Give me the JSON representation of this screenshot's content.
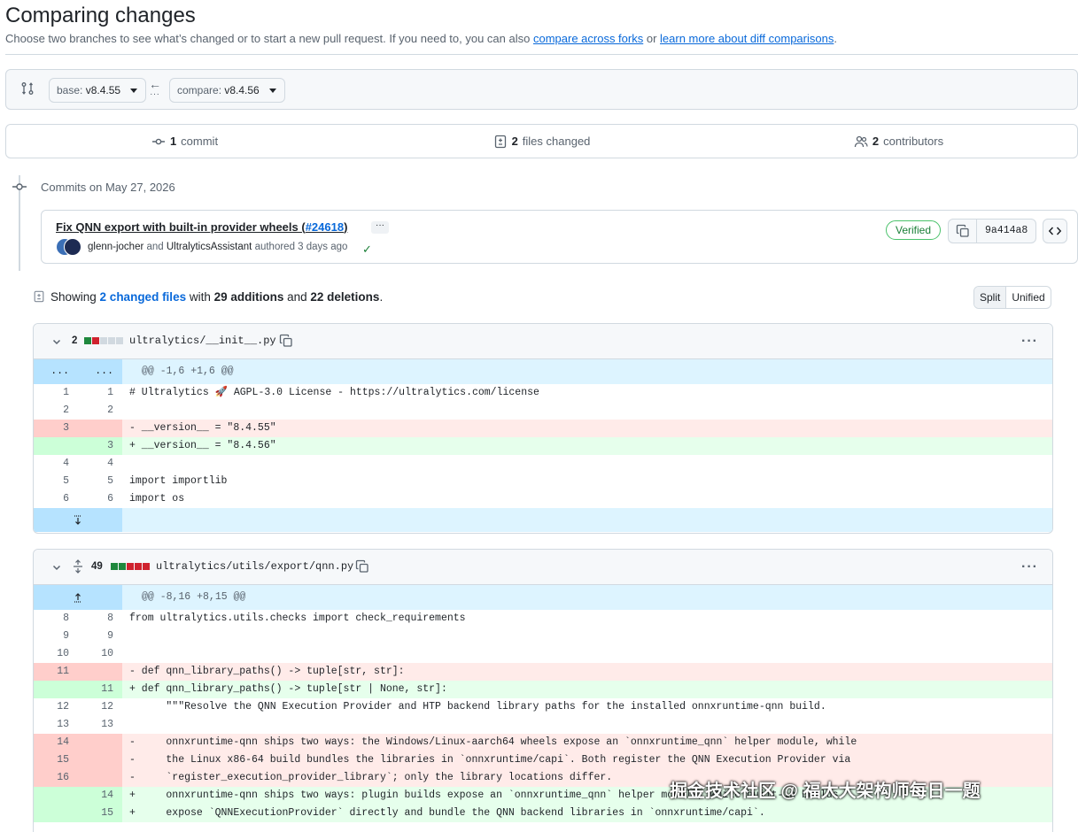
{
  "header": {
    "title": "Comparing changes",
    "subtitle_prefix": "Choose two branches to see what’s changed or to start a new pull request. If you need to, you can also ",
    "link_forks": "compare across forks",
    "subtitle_or": " or ",
    "link_learn": "learn more about diff comparisons",
    "subtitle_end": "."
  },
  "range": {
    "base_label": "base: ",
    "base_value": "v8.4.55",
    "compare_label": "compare: ",
    "compare_value": "v8.4.56",
    "arrow": "←",
    "dots": "..."
  },
  "stats": {
    "commits_count": "1",
    "commits_label": "commit",
    "files_count": "2",
    "files_label": "files changed",
    "contributors_count": "2",
    "contributors_label": "contributors"
  },
  "commits": {
    "date_label": "Commits on May 27, 2026",
    "title": "Fix QNN export with built-in provider wheels (",
    "pr": "#24618",
    "title_end": ")",
    "more": "···",
    "author1": "glenn-jocher",
    "and": " and ",
    "author2": "UltralyticsAssistant",
    "authored": " authored 3 days ago",
    "verified": "Verified",
    "sha": "9a414a8"
  },
  "summary": {
    "showing": "Showing ",
    "changed_files": "2 changed files",
    "with": " with ",
    "additions": "29 additions",
    "and": " and ",
    "deletions": "22 deletions",
    "end": "."
  },
  "view": {
    "split": "Split",
    "unified": "Unified"
  },
  "file1": {
    "count": "2",
    "name": "ultralytics/__init__.py",
    "hunk": "@@ -1,6 +1,6 @@",
    "hunk_dots": "...",
    "lines": [
      {
        "o": "1",
        "n": "1",
        "t": "ctx",
        "code": "# Ultralytics 🚀 AGPL-3.0 License - https://ultralytics.com/license"
      },
      {
        "o": "2",
        "n": "2",
        "t": "ctx",
        "code": ""
      },
      {
        "o": "3",
        "n": "",
        "t": "del",
        "code": "- __version__ = \"8.4.55\""
      },
      {
        "o": "",
        "n": "3",
        "t": "add",
        "code": "+ __version__ = \"8.4.56\""
      },
      {
        "o": "4",
        "n": "4",
        "t": "ctx",
        "code": ""
      },
      {
        "o": "5",
        "n": "5",
        "t": "ctx",
        "code": "import importlib"
      },
      {
        "o": "6",
        "n": "6",
        "t": "ctx",
        "code": "import os"
      }
    ]
  },
  "file2": {
    "count": "49",
    "name": "ultralytics/utils/export/qnn.py",
    "hunk": "@@ -8,16 +8,15 @@",
    "lines": [
      {
        "o": "8",
        "n": "8",
        "t": "ctx",
        "code": "from ultralytics.utils.checks import check_requirements"
      },
      {
        "o": "9",
        "n": "9",
        "t": "ctx",
        "code": ""
      },
      {
        "o": "10",
        "n": "10",
        "t": "ctx",
        "code": ""
      },
      {
        "o": "11",
        "n": "",
        "t": "del",
        "code": "- def qnn_library_paths() -> tuple[str, str]:"
      },
      {
        "o": "",
        "n": "11",
        "t": "add",
        "code": "+ def qnn_library_paths() -> tuple[str | None, str]:"
      },
      {
        "o": "12",
        "n": "12",
        "t": "ctx",
        "code": "      \"\"\"Resolve the QNN Execution Provider and HTP backend library paths for the installed onnxruntime-qnn build."
      },
      {
        "o": "13",
        "n": "13",
        "t": "ctx",
        "code": ""
      },
      {
        "o": "14",
        "n": "",
        "t": "del",
        "code": "-     onnxruntime-qnn ships two ways: the Windows/Linux-aarch64 wheels expose an `onnxruntime_qnn` helper module, while"
      },
      {
        "o": "15",
        "n": "",
        "t": "del",
        "code": "-     the Linux x86-64 build bundles the libraries in `onnxruntime/capi`. Both register the QNN Execution Provider via"
      },
      {
        "o": "16",
        "n": "",
        "t": "del",
        "code": "-     `register_execution_provider_library`; only the library locations differ."
      },
      {
        "o": "",
        "n": "14",
        "t": "add",
        "code": "+     onnxruntime-qnn ships two ways: plugin builds expose an `onnxruntime_qnn` helper module, while built-in builds"
      },
      {
        "o": "",
        "n": "15",
        "t": "add",
        "code": "+     expose `QNNExecutionProvider` directly and bundle the QNN backend libraries in `onnxruntime/capi`."
      }
    ]
  },
  "watermark": "掘金技术社区 @ 福大大架构师每日一题",
  "colors": {
    "link": "#0969da",
    "add_bg": "#e6ffec",
    "del_bg": "#ffebe9",
    "hunk_bg": "#ddf4ff"
  }
}
